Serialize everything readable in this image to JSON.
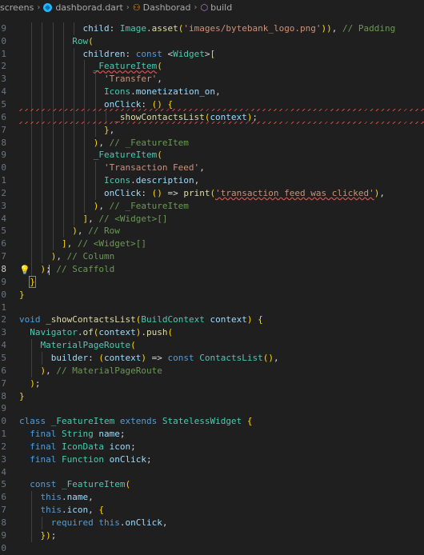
{
  "breadcrumb": {
    "segments": [
      "screens",
      "dashborad.dart",
      "Dashborad",
      "build"
    ],
    "icons": [
      "dart-file-icon",
      "class-icon",
      "method-icon"
    ]
  },
  "editor": {
    "active_line": "8",
    "lines": [
      {
        "ln": "",
        "text": ""
      },
      {
        "ln": "9",
        "text": "            child: Image.asset('images/bytebank_logo.png')), // Padding"
      },
      {
        "ln": "0",
        "text": "          Row("
      },
      {
        "ln": "1",
        "text": "            children: const <Widget>["
      },
      {
        "ln": "2",
        "text": "              _FeatureItem("
      },
      {
        "ln": "3",
        "text": "                'Transfer',"
      },
      {
        "ln": "4",
        "text": "                Icons.monetization_on,"
      },
      {
        "ln": "5",
        "text": "                onClick: () {"
      },
      {
        "ln": "6",
        "text": "                  _showContactsList(context);"
      },
      {
        "ln": "7",
        "text": "                },"
      },
      {
        "ln": "8",
        "text": "              ), // _FeatureItem"
      },
      {
        "ln": "9",
        "text": "              _FeatureItem("
      },
      {
        "ln": "0",
        "text": "                'Transaction Feed',"
      },
      {
        "ln": "1",
        "text": "                Icons.description,"
      },
      {
        "ln": "2",
        "text": "                onClick: () => print('transaction feed was clicked'),"
      },
      {
        "ln": "3",
        "text": "              ), // _FeatureItem"
      },
      {
        "ln": "4",
        "text": "            ], // <Widget>[]"
      },
      {
        "ln": "5",
        "text": "          ), // Row"
      },
      {
        "ln": "6",
        "text": "        ], // <Widget>[]"
      },
      {
        "ln": "7",
        "text": "      ), // Column"
      },
      {
        "ln": "8",
        "text": "    ); // Scaffold"
      },
      {
        "ln": "9",
        "text": "  }"
      },
      {
        "ln": "0",
        "text": "}"
      },
      {
        "ln": "1",
        "text": ""
      },
      {
        "ln": "2",
        "text": "void _showContactsList(BuildContext context) {"
      },
      {
        "ln": "3",
        "text": "  Navigator.of(context).push("
      },
      {
        "ln": "4",
        "text": "    MaterialPageRoute("
      },
      {
        "ln": "5",
        "text": "      builder: (context) => const ContactsList(),"
      },
      {
        "ln": "6",
        "text": "    ), // MaterialPageRoute"
      },
      {
        "ln": "7",
        "text": "  );"
      },
      {
        "ln": "8",
        "text": "}"
      },
      {
        "ln": "9",
        "text": ""
      },
      {
        "ln": "0",
        "text": "class _FeatureItem extends StatelessWidget {"
      },
      {
        "ln": "1",
        "text": "  final String name;"
      },
      {
        "ln": "2",
        "text": "  final IconData icon;"
      },
      {
        "ln": "3",
        "text": "  final Function onClick;"
      },
      {
        "ln": "4",
        "text": ""
      },
      {
        "ln": "5",
        "text": "  const _FeatureItem("
      },
      {
        "ln": "6",
        "text": "    this.name,"
      },
      {
        "ln": "7",
        "text": "    this.icon, {"
      },
      {
        "ln": "8",
        "text": "      required this.onClick,"
      },
      {
        "ln": "9",
        "text": "    });"
      },
      {
        "ln": "0",
        "text": ""
      }
    ]
  },
  "colors": {
    "background": "#1f1f1f",
    "keyword": "#569cd6",
    "control": "#c586c0",
    "type": "#4ec9b0",
    "function": "#dcdcaa",
    "string": "#ce9178",
    "variable": "#9cdcfe",
    "comment": "#6a9955",
    "error_squiggle": "#e05252"
  }
}
